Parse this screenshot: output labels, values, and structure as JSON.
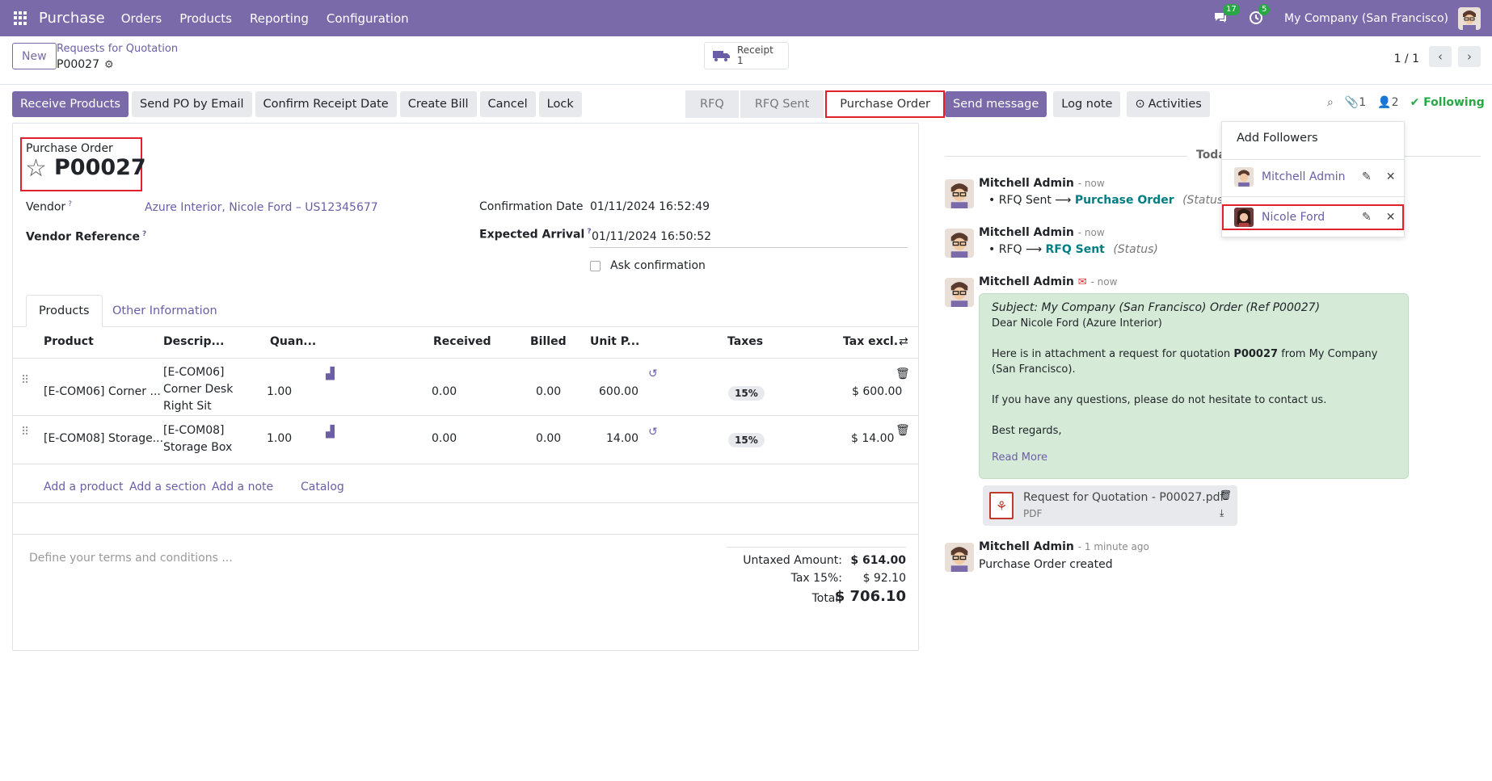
{
  "navbar": {
    "app_name": "Purchase",
    "menus": [
      "Orders",
      "Products",
      "Reporting",
      "Configuration"
    ],
    "messages_count": "17",
    "activities_count": "5",
    "company": "My Company (San Francisco)"
  },
  "control_panel": {
    "new_label": "New",
    "breadcrumb_parent": "Requests for Quotation",
    "record_name": "P00027",
    "receipt_label": "Receipt",
    "receipt_count": "1",
    "pager": "1 / 1"
  },
  "actions": {
    "receive_products": "Receive Products",
    "send_po_email": "Send PO by Email",
    "confirm_receipt_date": "Confirm Receipt Date",
    "create_bill": "Create Bill",
    "cancel": "Cancel",
    "lock": "Lock"
  },
  "status_bar": {
    "stages": [
      "RFQ",
      "RFQ Sent",
      "Purchase Order"
    ],
    "active": "Purchase Order"
  },
  "form": {
    "title_label": "Purchase Order",
    "order_number": "P00027",
    "vendor_label": "Vendor",
    "vendor_value": "Azure Interior, Nicole Ford – US12345677",
    "vendor_ref_label": "Vendor Reference",
    "confirmation_date_label": "Confirmation Date",
    "confirmation_date_value": "01/11/2024 16:52:49",
    "expected_arrival_label": "Expected Arrival",
    "expected_arrival_value": "01/11/2024 16:50:52",
    "ask_confirmation_label": "Ask confirmation",
    "help_mark": "?"
  },
  "tabs": [
    "Products",
    "Other Information"
  ],
  "table": {
    "headers": [
      "Product",
      "Descrip...",
      "Quan...",
      "Received",
      "Billed",
      "Unit P...",
      "Taxes",
      "Tax excl."
    ],
    "rows": [
      {
        "product": "[E-COM06] Corner ...",
        "desc1": "[E-COM06]",
        "desc2": "Corner Desk",
        "desc3": "Right Sit",
        "qty": "1.00",
        "received": "0.00",
        "billed": "0.00",
        "unit_price": "600.00",
        "tax": "15%",
        "subtotal": "$ 600.00"
      },
      {
        "product": "[E-COM08] Storage...",
        "desc1": "[E-COM08]",
        "desc2": "Storage Box",
        "desc3": "",
        "qty": "1.00",
        "received": "0.00",
        "billed": "0.00",
        "unit_price": "14.00",
        "tax": "15%",
        "subtotal": "$ 14.00"
      }
    ],
    "add_product": "Add a product",
    "add_section": "Add a section",
    "add_note": "Add a note",
    "catalog": "Catalog"
  },
  "terms_placeholder": "Define your terms and conditions ...",
  "totals": {
    "untaxed_label": "Untaxed Amount:",
    "untaxed_value": "$ 614.00",
    "tax_label": "Tax 15%:",
    "tax_value": "$ 92.10",
    "total_label": "Total:",
    "total_value": "$ 706.10"
  },
  "chatter": {
    "send_message": "Send message",
    "log_note": "Log note",
    "activities": "Activities",
    "attachments_count": "1",
    "followers_count": "2",
    "following": "Following",
    "today": "Toda",
    "messages": [
      {
        "author": "Mitchell Admin",
        "time": "- now",
        "from": "RFQ Sent",
        "to": "Purchase Order",
        "field": "(Status)"
      },
      {
        "author": "Mitchell Admin",
        "time": "- now",
        "from": "RFQ",
        "to": "RFQ Sent",
        "field": "(Status)"
      }
    ],
    "email": {
      "author": "Mitchell Admin",
      "time": "- now",
      "subject": "Subject: My Company (San Francisco) Order (Ref P00027)",
      "greeting": "Dear Nicole Ford (Azure Interior)",
      "body_pre": "Here is in attachment a request for quotation ",
      "body_ref": "P00027",
      "body_post": " from My Company (San Francisco).",
      "questions": "If you have any questions, please do not hesitate to contact us.",
      "regards": "Best regards,",
      "read_more": "Read More"
    },
    "attachment": {
      "name": "Request for Quotation - P00027.pdf",
      "type": "PDF"
    },
    "created": {
      "author": "Mitchell Admin",
      "time": "- 1 minute ago",
      "text": "Purchase Order created"
    }
  },
  "followers_dropdown": {
    "add_followers": "Add Followers",
    "followers": [
      "Mitchell Admin",
      "Nicole Ford"
    ]
  },
  "colors": {
    "brand": "#7a6aa9",
    "highlight": "#e0202c",
    "success": "#28a745",
    "email_bg": "#d5ebd8"
  }
}
